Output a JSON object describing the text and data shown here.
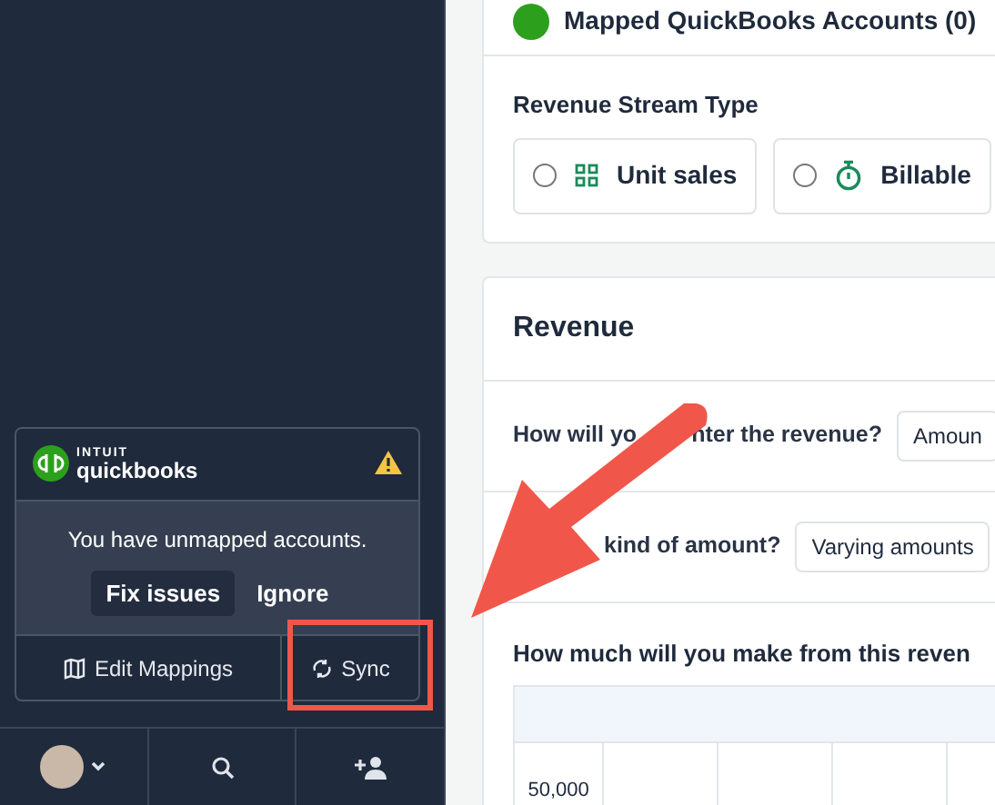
{
  "sidebar": {
    "integration": {
      "brand_small": "INTUIT",
      "brand": "quickbooks",
      "warning": true,
      "message": "You have unmapped accounts.",
      "actions": [
        "Fix issues",
        "Ignore"
      ],
      "footer_buttons": [
        {
          "label": "Edit Mappings",
          "kind": "map"
        },
        {
          "label": "Sync",
          "kind": "sync"
        }
      ]
    }
  },
  "mapped_accounts": {
    "title": "Mapped QuickBooks Accounts (0)"
  },
  "revenue_stream_type": {
    "label": "Revenue Stream Type",
    "options": [
      {
        "label": "Unit sales",
        "kind": "grid",
        "selected": false
      },
      {
        "label": "Billable",
        "kind": "timer",
        "selected": false
      }
    ]
  },
  "revenue": {
    "title": "Revenue",
    "questions": [
      {
        "label_parts": [
          "How will yo",
          "nter the revenue?"
        ],
        "covered_start": false,
        "value": "Amoun"
      },
      {
        "label_parts": [
          "kind of amount?"
        ],
        "covered_start": true,
        "value": "Varying amounts"
      }
    ],
    "table_prompt": "How much will you make from this reven",
    "table": {
      "rows": [
        {
          "cells": [
            "50,000",
            "",
            "",
            "",
            ""
          ]
        }
      ]
    }
  },
  "annotation_arrow": true,
  "annotation_highlight": true
}
